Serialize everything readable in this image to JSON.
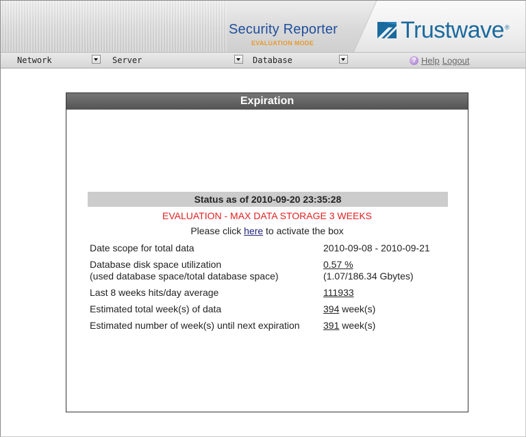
{
  "header": {
    "product_name": "Security Reporter",
    "product_mode": "EVALUATION MODE",
    "brand_name": "Trustwave",
    "brand_reg": "®",
    "brand_icon": "trustwave-logo-icon"
  },
  "menubar": {
    "network_label": "Network",
    "server_label": "Server",
    "database_label": "Database",
    "help_label": "Help",
    "logout_label": "Logout",
    "help_icon": "question-icon"
  },
  "panel": {
    "title": "Expiration",
    "status_label": "Status as of 2010-09-20 23:35:28",
    "evaluation_notice": "EVALUATION - MAX DATA STORAGE 3 WEEKS",
    "activate_prefix": "Please click ",
    "activate_link": "here",
    "activate_suffix": " to activate the box",
    "rows": [
      {
        "label": "Date scope for total data",
        "value": "2010-09-08 - 2010-09-21"
      },
      {
        "label": "Database disk space utilization",
        "sublabel": "(used database space/total database space)",
        "value": "0.57 %",
        "subvalue": "(1.07/186.34 Gbytes)"
      },
      {
        "label": "Last 8 weeks hits/day average",
        "value": "111933"
      },
      {
        "label": "Estimated total week(s) of data",
        "value": "394",
        "unit": " week(s)"
      },
      {
        "label": "Estimated number of week(s) until next expiration",
        "value": "391",
        "unit": " week(s)"
      }
    ]
  },
  "colors": {
    "brand_blue": "#1b6a9e",
    "product_blue": "#1f4e9c",
    "mode_orange": "#e69a2e",
    "alert_red": "#e02020",
    "title_bar": "#5c5c5c"
  }
}
